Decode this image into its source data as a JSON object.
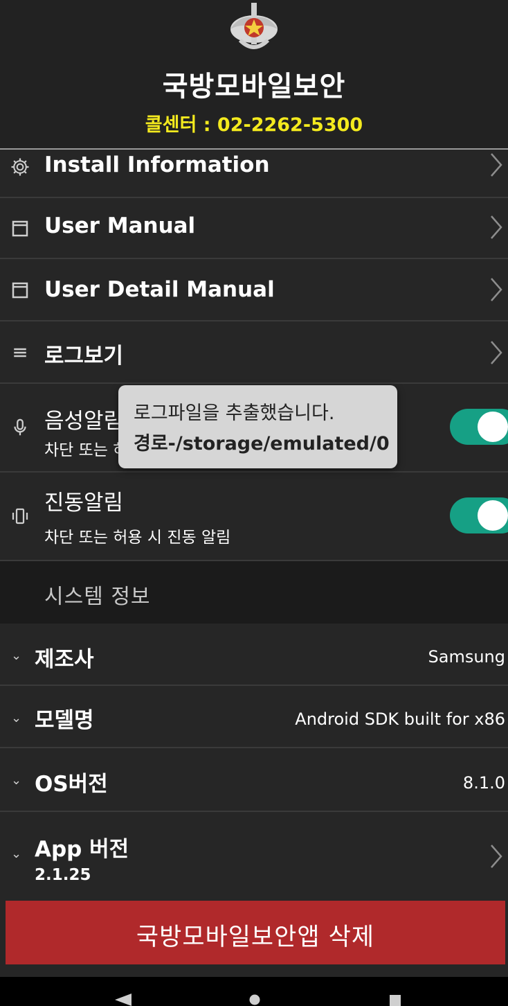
{
  "header": {
    "title": "국방모바일보안",
    "call_center": "콜센터 : 02-2262-5300"
  },
  "menu": {
    "install_info": "Install Information",
    "user_manual": "User Manual",
    "user_detail_manual": "User Detail Manual",
    "view_log": "로그보기"
  },
  "voice_alert": {
    "title": "음성알림",
    "subtitle": "차단 또는 허용 시 음성 알림",
    "enabled": true
  },
  "vibrate_alert": {
    "title": "진동알림",
    "subtitle": "차단 또는 허용 시 진동 알림",
    "enabled": true
  },
  "system_info": {
    "section_label": "시스템 정보",
    "manufacturer_label": "제조사",
    "manufacturer_value": "Samsung",
    "model_label": "모델명",
    "model_value": "Android SDK built for x86",
    "os_label": "OS버전",
    "os_value": "8.1.0",
    "app_label": "App 버전",
    "app_value": "2.1.25"
  },
  "delete_button": "국방모바일보안앱 삭제",
  "toast": {
    "line1": "로그파일을 추출했습니다.",
    "line2": "경로-/storage/emulated/0"
  },
  "colors": {
    "accent_yellow": "#f4ea1e",
    "toggle_on": "#16a085",
    "delete_red": "#b0292b"
  },
  "icons": [
    "emblem-logo",
    "gear-icon",
    "book-icon",
    "list-icon",
    "microphone-icon",
    "vibrate-icon",
    "chevron-right-icon",
    "chevron-down-icon",
    "nav-back-icon",
    "nav-home-icon",
    "nav-recents-icon"
  ]
}
